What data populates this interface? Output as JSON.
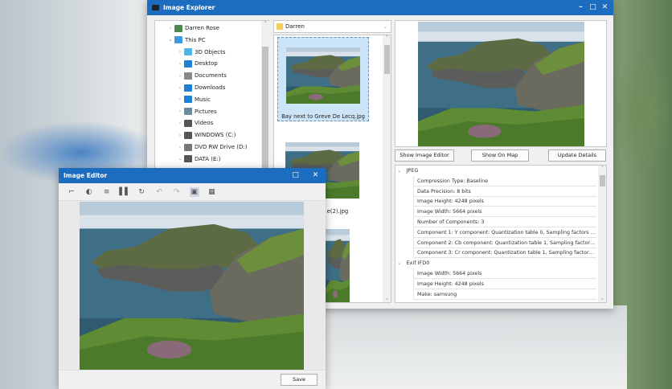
{
  "explorer": {
    "title": "Image Explorer",
    "tree": [
      {
        "label": "Darren Rose",
        "icon": "user-icon",
        "expanded": false
      },
      {
        "label": "This PC",
        "icon": "computer-icon",
        "expanded": true
      },
      {
        "label": "3D Objects",
        "icon": "cube-icon"
      },
      {
        "label": "Desktop",
        "icon": "desktop-icon"
      },
      {
        "label": "Documents",
        "icon": "document-icon"
      },
      {
        "label": "Downloads",
        "icon": "download-icon"
      },
      {
        "label": "Music",
        "icon": "music-icon"
      },
      {
        "label": "Pictures",
        "icon": "pictures-icon"
      },
      {
        "label": "Videos",
        "icon": "video-icon"
      },
      {
        "label": "WINDOWS  (C:)",
        "icon": "drive-icon"
      },
      {
        "label": "DVD RW Drive (D:)",
        "icon": "dvd-icon"
      },
      {
        "label": "DATA (E:)",
        "icon": "drive-icon",
        "expanded": true
      }
    ],
    "folder_select": "Darren",
    "thumbnails": [
      {
        "label": "Bay next to Greve De Lecq.jpg",
        "selected": true
      },
      {
        "label": "e(2).jpg"
      }
    ],
    "buttons": {
      "show_editor": "Show Image Editor",
      "show_map": "Show On Map",
      "update": "Update Details"
    },
    "properties": [
      {
        "group": "JPEG",
        "items": [
          "Compression Type: Baseline",
          "Data Precision: 8 bits",
          "Image Height: 4248 pixels",
          "Image Width: 5664 pixels",
          "Number of Components: 3",
          "Component 1: Y component: Quantization table 0, Sampling factors 2 hor...",
          "Component 2: Cb component: Quantization table 1, Sampling factors 1 h...",
          "Component 3: Cr component: Quantization table 1, Sampling factors 1 h..."
        ]
      },
      {
        "group": "Exif IFD0",
        "items": [
          "Image Width: 5664 pixels",
          "Image Height: 4248 pixels",
          "Make: samsung"
        ]
      }
    ]
  },
  "editor": {
    "title": "Image Editor",
    "tools": [
      "crop-icon",
      "contrast-icon",
      "adjust-icon",
      "flip-icon",
      "rotate-icon",
      "undo-icon",
      "redo-icon",
      "fit-icon",
      "grid-icon"
    ],
    "save": "Save"
  },
  "colors": {
    "titlebar": "#1c6dbf",
    "selection": "#cce4f7"
  }
}
